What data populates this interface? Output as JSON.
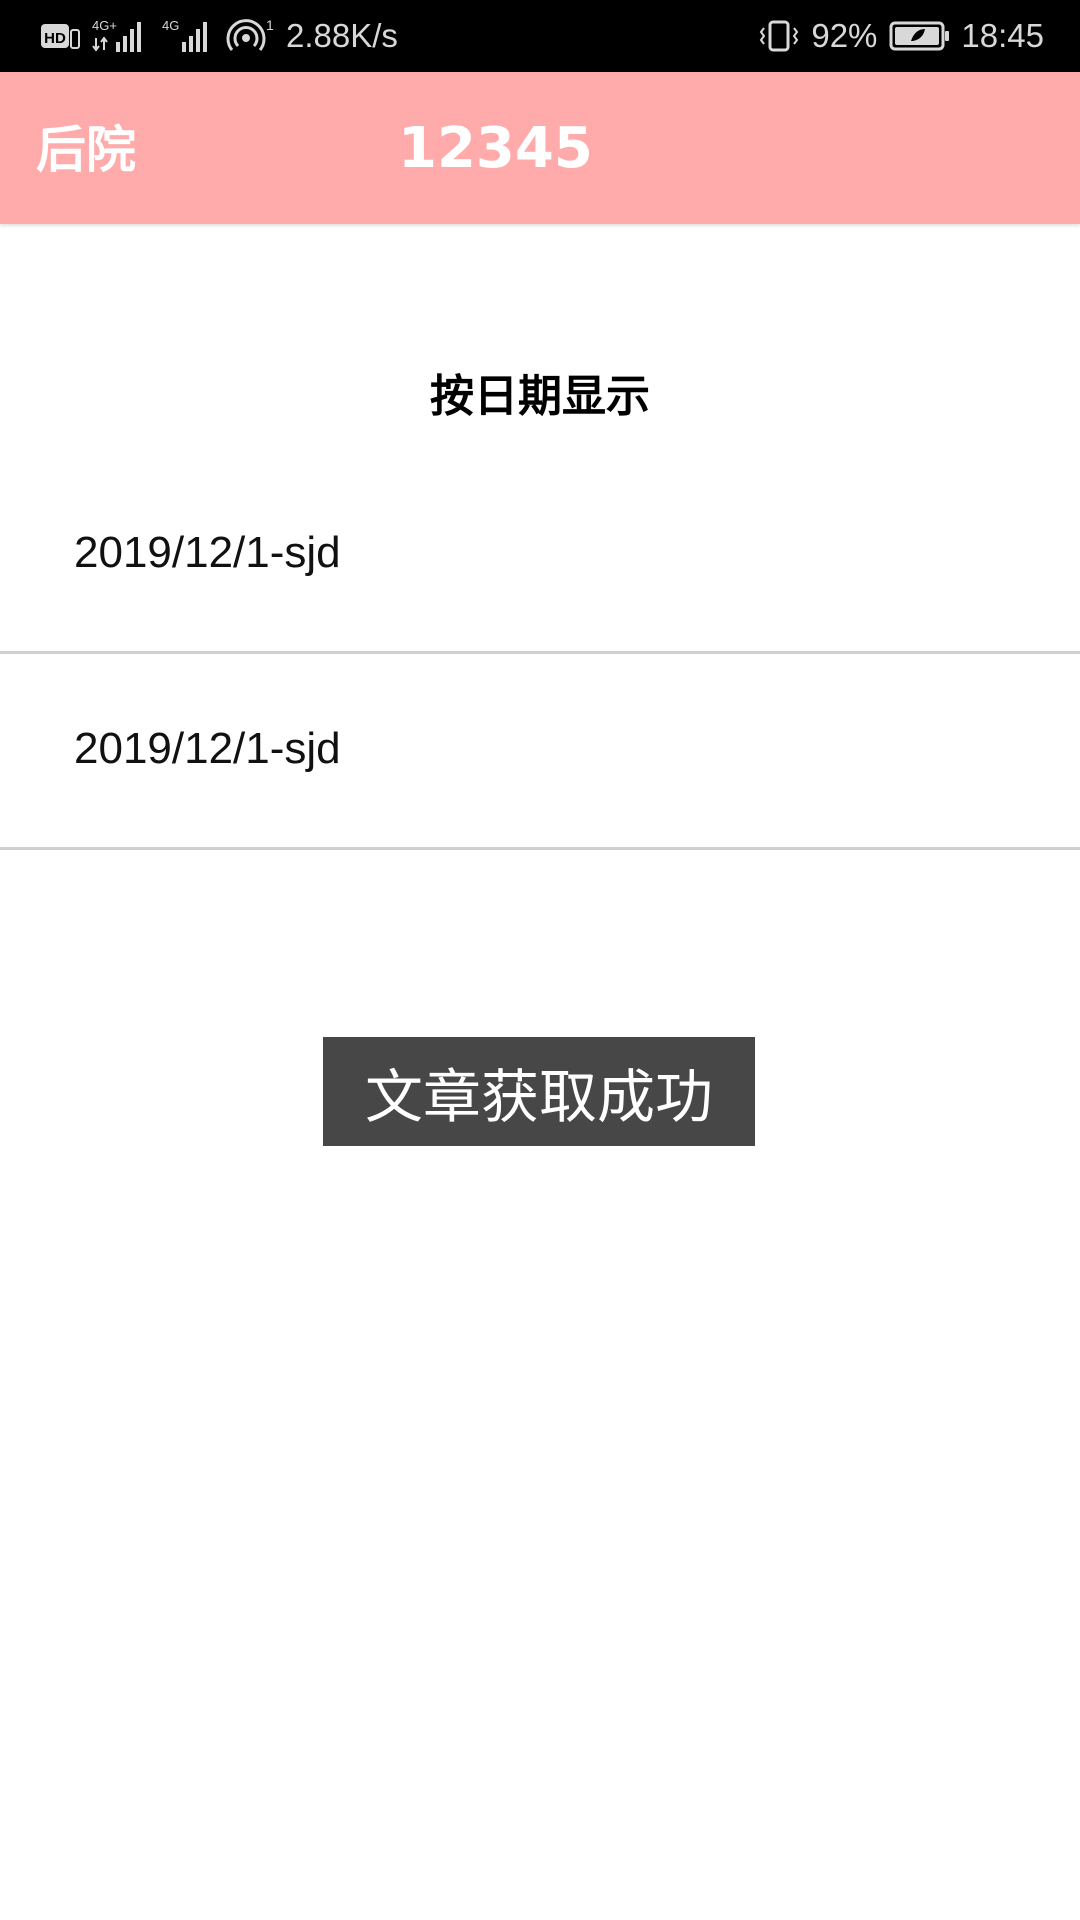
{
  "status_bar": {
    "hd_label": "HD",
    "sim1_label": "4G+",
    "sim2_label": "4G",
    "hotspot_count": "1",
    "network_speed": "2.88K/s",
    "battery_percent": "92%",
    "time": "18:45",
    "icons": [
      "hd-icon",
      "sim1-signal-icon",
      "sim2-signal-icon",
      "hotspot-icon",
      "vibrate-icon",
      "battery-icon"
    ]
  },
  "toolbar": {
    "back_label": "后院",
    "title": "12345",
    "background_color": "#ffabab"
  },
  "content": {
    "heading": "按日期显示",
    "items": [
      {
        "label": "2019/12/1-sjd"
      },
      {
        "label": "2019/12/1-sjd"
      }
    ]
  },
  "toast": {
    "message": "文章获取成功"
  }
}
